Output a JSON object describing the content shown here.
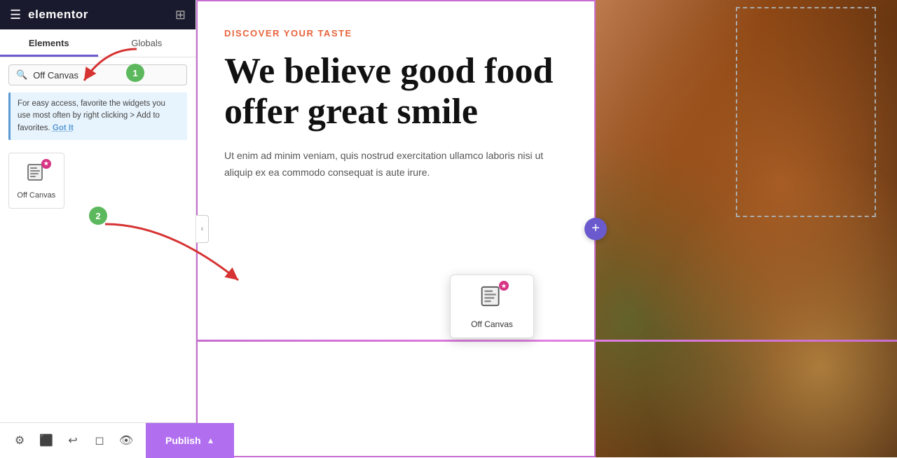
{
  "sidebar": {
    "header": {
      "logo_text": "elementor",
      "hamburger_icon": "☰",
      "grid_icon": "⊞"
    },
    "tabs": [
      {
        "id": "elements",
        "label": "Elements",
        "active": true
      },
      {
        "id": "globals",
        "label": "Globals",
        "active": false
      }
    ],
    "search": {
      "placeholder": "Off Canvas",
      "icon": "🔍"
    },
    "tip": {
      "text": "For easy access, favorite the widgets you use most often by right clicking > Add to favorites.",
      "link_text": "Got It"
    },
    "widget": {
      "icon": "📋",
      "label": "Off Canvas",
      "pro_badge": "★"
    },
    "floating_widget": {
      "icon": "📋",
      "label": "Off Canvas",
      "pro_badge": "★"
    },
    "bottom": {
      "settings_icon": "⚙",
      "layers_icon": "⬛",
      "history_icon": "↩",
      "responsive_icon": "◻",
      "preview_icon": "👁",
      "publish_label": "Publish",
      "chevron_icon": "▲"
    }
  },
  "badges": {
    "badge1_label": "1",
    "badge2_label": "2"
  },
  "main": {
    "discover_label": "DISCOVER YOUR TASTE",
    "heading_line1": "We believe good food",
    "heading_line2": "offer great smile",
    "body_text": "Ut enim ad minim veniam, quis nostrud exercitation ullamco laboris nisi ut aliquip ex ea commodo consequat is aute irure."
  }
}
